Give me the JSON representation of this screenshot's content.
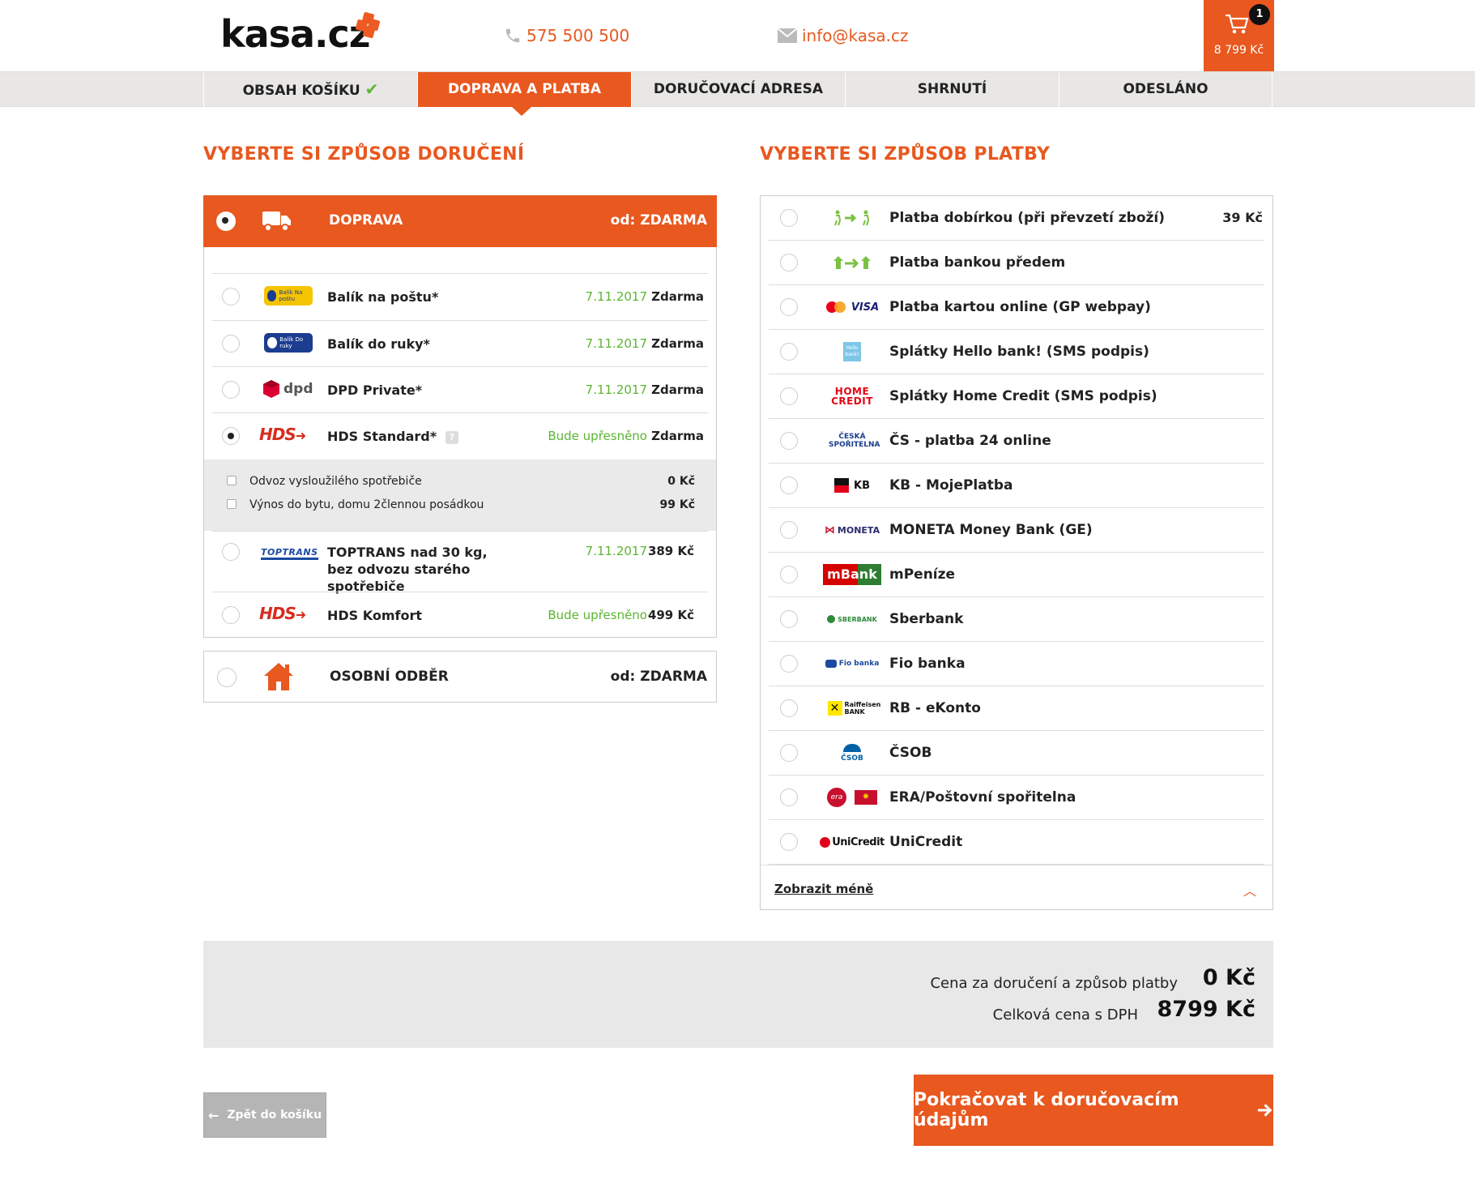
{
  "header": {
    "logo_text": "kasa.cz",
    "phone": "575 500 500",
    "email": "info@kasa.cz",
    "cart_count": "1",
    "cart_total": "8 799 Kč"
  },
  "steps": [
    {
      "label": "OBSAH KOŠÍKU",
      "done": true
    },
    {
      "label": "DOPRAVA A PLATBA",
      "active": true
    },
    {
      "label": "DORUČOVACÍ ADRESA"
    },
    {
      "label": "SHRNUTÍ"
    },
    {
      "label": "ODESLÁNO"
    }
  ],
  "delivery": {
    "title": "VYBERTE SI ZPŮSOB DORUČENÍ",
    "group_doprava": {
      "label": "DOPRAVA",
      "price": "od: ZDARMA"
    },
    "options": [
      {
        "logo": "Balík Na poštu",
        "name": "Balík na poštu*",
        "date": "7.11.2017",
        "price": "Zdarma"
      },
      {
        "logo": "Balík Do ruky",
        "name": "Balík do ruky*",
        "date": "7.11.2017",
        "price": "Zdarma"
      },
      {
        "logo": "dpd",
        "name": "DPD Private*",
        "date": "7.11.2017",
        "price": "Zdarma"
      },
      {
        "logo": "HDS",
        "name": "HDS Standard*",
        "date": "Bude upřesněno",
        "price": "Zdarma"
      },
      {
        "logo": "TOPTRANS",
        "name": "TOPTRANS nad 30 kg, bez odvozu starého spotřebiče",
        "date": "7.11.2017",
        "price": "389 Kč"
      },
      {
        "logo": "HDS",
        "name": "HDS Komfort",
        "date": "Bude upřesněno",
        "price": "499 Kč"
      }
    ],
    "extras": [
      {
        "label": "Odvoz vysloužilého spotřebiče",
        "price": "0 Kč"
      },
      {
        "label": "Výnos do bytu, domu 2člennou posádkou",
        "price": "99 Kč"
      }
    ],
    "group_osobni": {
      "label": "OSOBNÍ ODBĚR",
      "price": "od: ZDARMA"
    }
  },
  "payment": {
    "title": "VYBERTE SI ZPŮSOB PLATBY",
    "options": [
      {
        "logo": "cod-icon",
        "name": "Platba dobírkou (při převzetí zboží)",
        "price": "39 Kč"
      },
      {
        "logo": "bank-transfer-icon",
        "name": "Platba bankou předem",
        "price": ""
      },
      {
        "logo": "VISA",
        "name": "Platba kartou online (GP webpay)",
        "price": ""
      },
      {
        "logo": "Hello bank!",
        "name": "Splátky Hello bank! (SMS podpis)",
        "price": ""
      },
      {
        "logo": "HOME CREDIT",
        "name": "Splátky Home Credit (SMS podpis)",
        "price": ""
      },
      {
        "logo": "ČESKÁ SPOŘITELNA",
        "name": "ČS - platba 24 online",
        "price": ""
      },
      {
        "logo": "KB",
        "name": "KB - MojePlatba",
        "price": ""
      },
      {
        "logo": "MONETA",
        "name": "MONETA Money Bank (GE)",
        "price": ""
      },
      {
        "logo": "mBank",
        "name": "mPeníze",
        "price": ""
      },
      {
        "logo": "SBERBANK",
        "name": "Sberbank",
        "price": ""
      },
      {
        "logo": "Fio banka",
        "name": "Fio banka",
        "price": ""
      },
      {
        "logo": "Raiffeisen BANK",
        "name": "RB - eKonto",
        "price": ""
      },
      {
        "logo": "ČSOB",
        "name": "ČSOB",
        "price": ""
      },
      {
        "logo": "era",
        "name": "ERA/Poštovní spořitelna",
        "price": ""
      },
      {
        "logo": "UniCredit",
        "name": "UniCredit",
        "price": ""
      }
    ],
    "show_less": "Zobrazit méně"
  },
  "summary": {
    "delivery_label": "Cena za doručení a způsob platby",
    "delivery_value": "0 Kč",
    "total_label": "Celková cena s DPH",
    "total_value": "8799 Kč"
  },
  "buttons": {
    "back": "Zpět do košíku",
    "next": "Pokračovat k doručovacím údajům"
  },
  "colors": {
    "accent": "#e8581f",
    "green": "#5bb531"
  }
}
